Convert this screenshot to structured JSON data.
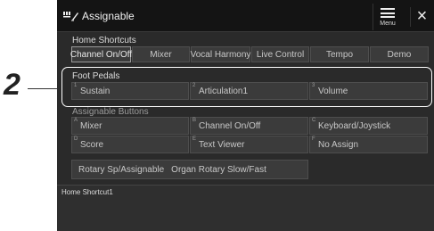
{
  "callout": {
    "number": "2"
  },
  "window": {
    "title": "Assignable",
    "menu_label": "Menu",
    "close_label": "×"
  },
  "home_shortcuts": {
    "label": "Home Shortcuts",
    "buttons": [
      "Channel On/Off",
      "Mixer",
      "Vocal Harmony",
      "Live Control",
      "Tempo",
      "Demo"
    ],
    "selected": "Channel On/Off"
  },
  "foot_pedals": {
    "label": "Foot Pedals",
    "buttons": [
      {
        "index": "1",
        "label": "Sustain"
      },
      {
        "index": "2",
        "label": "Articulation1"
      },
      {
        "index": "3",
        "label": "Volume"
      }
    ]
  },
  "assignable_buttons": {
    "label": "Assignable Buttons",
    "buttons": [
      {
        "index": "A",
        "label": "Mixer"
      },
      {
        "index": "B",
        "label": "Channel On/Off"
      },
      {
        "index": "C",
        "label": "Keyboard/Joystick"
      },
      {
        "index": "D",
        "label": "Score"
      },
      {
        "index": "E",
        "label": "Text Viewer"
      },
      {
        "index": "F",
        "label": "No Assign"
      }
    ]
  },
  "rotary": {
    "label": "Rotary Sp/Assignable",
    "value": "Organ Rotary Slow/Fast"
  },
  "status": {
    "text": "Home Shortcut1"
  },
  "icons": {
    "app": "keyboard-pedal-icon",
    "menu": "hamburger-icon",
    "close": "close-icon"
  }
}
